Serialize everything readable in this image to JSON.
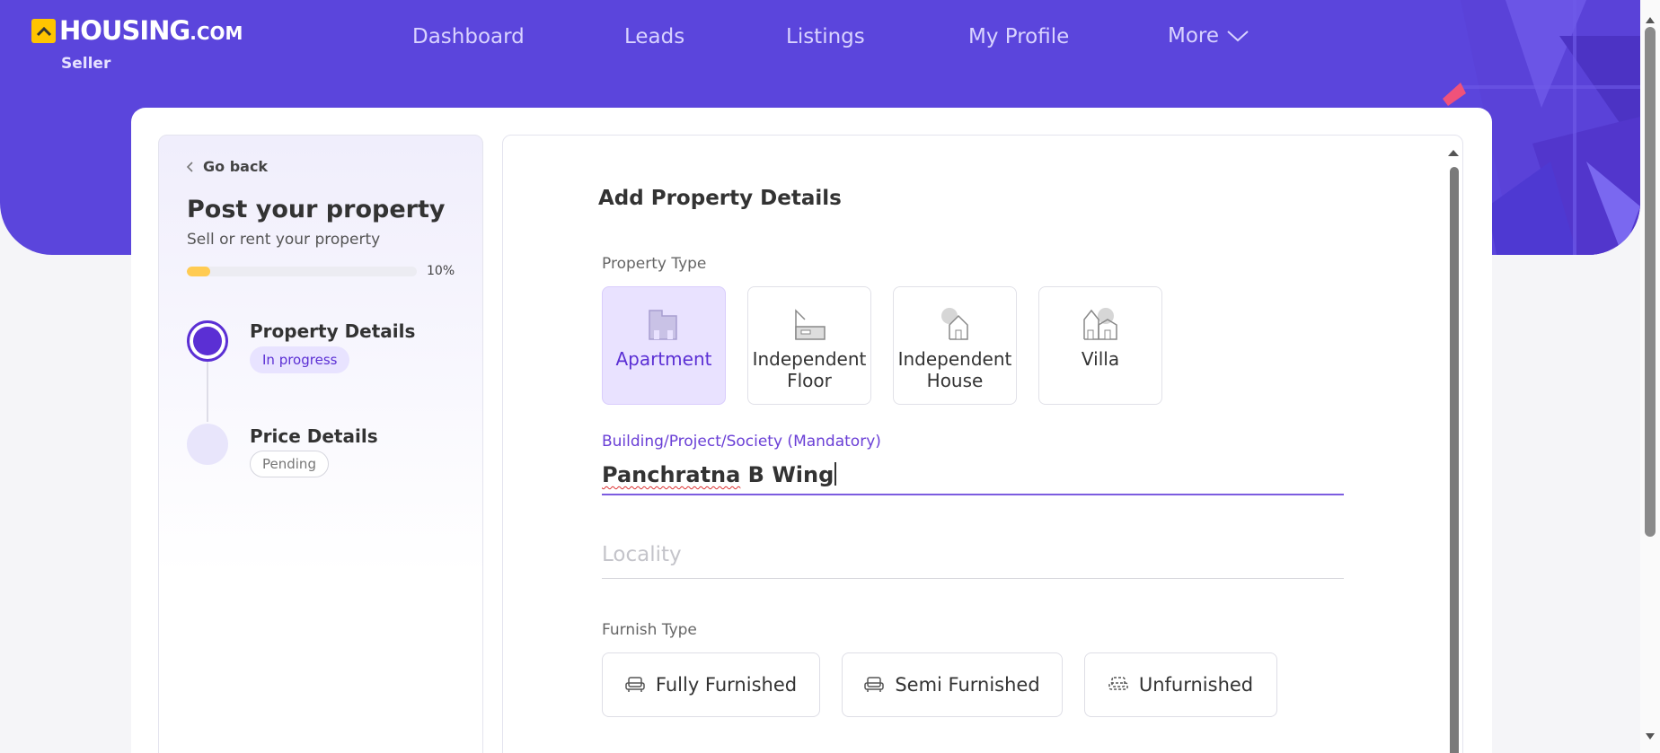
{
  "header": {
    "logo_main": "HOUSING",
    "logo_suffix": ".COM",
    "subtitle": "Seller",
    "nav": [
      "Dashboard",
      "Leads",
      "Listings",
      "My Profile",
      "More"
    ],
    "brand_color": "#5b45dc"
  },
  "sidebar": {
    "back_label": "Go back",
    "title": "Post your property",
    "subtitle": "Sell or rent your property",
    "progress_percent": 10,
    "progress_label": "10%",
    "steps": [
      {
        "title": "Property Details",
        "status": "In progress"
      },
      {
        "title": "Price Details",
        "status": "Pending"
      }
    ]
  },
  "form": {
    "title": "Add Property Details",
    "property_type_label": "Property Type",
    "property_types": [
      {
        "label": "Apartment",
        "icon": "apartment-icon",
        "selected": true
      },
      {
        "label": "Independent Floor",
        "icon": "floor-icon",
        "selected": false
      },
      {
        "label": "Independent House",
        "icon": "house-icon",
        "selected": false
      },
      {
        "label": "Villa",
        "icon": "villa-icon",
        "selected": false
      }
    ],
    "building_label": "Building/Project/Society (Mandatory)",
    "building_value": "Panchratna B Wing",
    "building_value_misspelled": "Panchratna",
    "building_value_rest": " B Wing",
    "locality_placeholder": "Locality",
    "furnish_label": "Furnish Type",
    "furnish_types": [
      "Fully Furnished",
      "Semi Furnished",
      "Unfurnished"
    ]
  }
}
